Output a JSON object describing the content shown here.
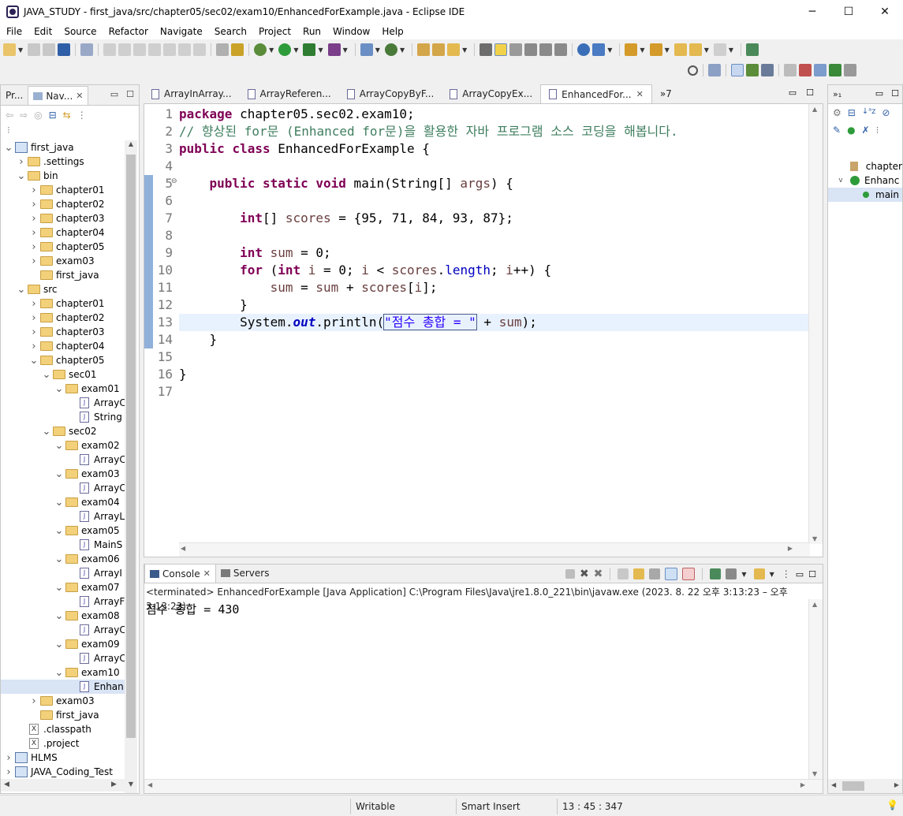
{
  "window": {
    "title": "JAVA_STUDY - first_java/src/chapter05/sec02/exam10/EnhancedForExample.java - Eclipse IDE",
    "minimize": "─",
    "maximize": "☐",
    "close": "✕"
  },
  "menu": [
    "File",
    "Edit",
    "Source",
    "Refactor",
    "Navigate",
    "Search",
    "Project",
    "Run",
    "Window",
    "Help"
  ],
  "left_panel": {
    "tabs": [
      {
        "label": "Pr...",
        "active": false
      },
      {
        "label": "Nav...",
        "active": true
      }
    ],
    "tree": [
      {
        "indent": 0,
        "chev": "v",
        "type": "project",
        "label": "first_java"
      },
      {
        "indent": 1,
        "chev": ">",
        "type": "folder",
        "label": ".settings"
      },
      {
        "indent": 1,
        "chev": "v",
        "type": "folder",
        "label": "bin"
      },
      {
        "indent": 2,
        "chev": ">",
        "type": "folder",
        "label": "chapter01"
      },
      {
        "indent": 2,
        "chev": ">",
        "type": "folder",
        "label": "chapter02"
      },
      {
        "indent": 2,
        "chev": ">",
        "type": "folder",
        "label": "chapter03"
      },
      {
        "indent": 2,
        "chev": ">",
        "type": "folder",
        "label": "chapter04"
      },
      {
        "indent": 2,
        "chev": ">",
        "type": "folder",
        "label": "chapter05"
      },
      {
        "indent": 2,
        "chev": ">",
        "type": "folder",
        "label": "exam03"
      },
      {
        "indent": 2,
        "chev": "",
        "type": "folder",
        "label": "first_java"
      },
      {
        "indent": 1,
        "chev": "v",
        "type": "folder",
        "label": "src"
      },
      {
        "indent": 2,
        "chev": ">",
        "type": "folder",
        "label": "chapter01"
      },
      {
        "indent": 2,
        "chev": ">",
        "type": "folder",
        "label": "chapter02"
      },
      {
        "indent": 2,
        "chev": ">",
        "type": "folder",
        "label": "chapter03"
      },
      {
        "indent": 2,
        "chev": ">",
        "type": "folder",
        "label": "chapter04"
      },
      {
        "indent": 2,
        "chev": "v",
        "type": "folder",
        "label": "chapter05"
      },
      {
        "indent": 3,
        "chev": "v",
        "type": "folder",
        "label": "sec01"
      },
      {
        "indent": 4,
        "chev": "v",
        "type": "folder",
        "label": "exam01"
      },
      {
        "indent": 5,
        "chev": "",
        "type": "java",
        "label": "ArrayC"
      },
      {
        "indent": 5,
        "chev": "",
        "type": "java",
        "label": "String"
      },
      {
        "indent": 3,
        "chev": "v",
        "type": "folder",
        "label": "sec02"
      },
      {
        "indent": 4,
        "chev": "v",
        "type": "folder",
        "label": "exam02"
      },
      {
        "indent": 5,
        "chev": "",
        "type": "java",
        "label": "ArrayC"
      },
      {
        "indent": 4,
        "chev": "v",
        "type": "folder",
        "label": "exam03"
      },
      {
        "indent": 5,
        "chev": "",
        "type": "java",
        "label": "ArrayC"
      },
      {
        "indent": 4,
        "chev": "v",
        "type": "folder",
        "label": "exam04"
      },
      {
        "indent": 5,
        "chev": "",
        "type": "java",
        "label": "ArrayL"
      },
      {
        "indent": 4,
        "chev": "v",
        "type": "folder",
        "label": "exam05"
      },
      {
        "indent": 5,
        "chev": "",
        "type": "java",
        "label": "MainS"
      },
      {
        "indent": 4,
        "chev": "v",
        "type": "folder",
        "label": "exam06"
      },
      {
        "indent": 5,
        "chev": "",
        "type": "java",
        "label": "ArrayI"
      },
      {
        "indent": 4,
        "chev": "v",
        "type": "folder",
        "label": "exam07"
      },
      {
        "indent": 5,
        "chev": "",
        "type": "java",
        "label": "ArrayF"
      },
      {
        "indent": 4,
        "chev": "v",
        "type": "folder",
        "label": "exam08"
      },
      {
        "indent": 5,
        "chev": "",
        "type": "java",
        "label": "ArrayC"
      },
      {
        "indent": 4,
        "chev": "v",
        "type": "folder",
        "label": "exam09"
      },
      {
        "indent": 5,
        "chev": "",
        "type": "java",
        "label": "ArrayC"
      },
      {
        "indent": 4,
        "chev": "v",
        "type": "folder",
        "label": "exam10"
      },
      {
        "indent": 5,
        "chev": "",
        "type": "java",
        "label": "Enhan",
        "selected": true
      },
      {
        "indent": 2,
        "chev": ">",
        "type": "folder",
        "label": "exam03"
      },
      {
        "indent": 2,
        "chev": "",
        "type": "folder",
        "label": "first_java"
      },
      {
        "indent": 1,
        "chev": "",
        "type": "xml",
        "label": ".classpath"
      },
      {
        "indent": 1,
        "chev": "",
        "type": "xml",
        "label": ".project"
      },
      {
        "indent": 0,
        "chev": ">",
        "type": "project",
        "label": "HLMS"
      },
      {
        "indent": 0,
        "chev": ">",
        "type": "project",
        "label": "JAVA_Coding_Test"
      }
    ]
  },
  "editor": {
    "tabs": [
      {
        "label": "ArrayInArray...",
        "active": false
      },
      {
        "label": "ArrayReferen...",
        "active": false
      },
      {
        "label": "ArrayCopyByF...",
        "active": false
      },
      {
        "label": "ArrayCopyEx...",
        "active": false
      },
      {
        "label": "EnhancedFor...",
        "active": true
      }
    ],
    "overflow": "»7",
    "line_numbers": [
      "1",
      "2",
      "3",
      "4",
      "5",
      "6",
      "7",
      "8",
      "9",
      "10",
      "11",
      "12",
      "13",
      "14",
      "15",
      "16",
      "17"
    ],
    "code": {
      "l1_kw": "package",
      "l1_rest": " chapter05.sec02.exam10;",
      "l2": "// 향상된 for문 (Enhanced for문)을 활용한 자바 프로그램 소스 코딩을 해봅니다.",
      "l3_kw1": "public",
      "l3_kw2": "class",
      "l3_rest": " EnhancedForExample {",
      "l5_kw": "public static void",
      "l5_rest1": " main(String[] ",
      "l5_args": "args",
      "l5_rest2": ") {",
      "l7_kw": "int",
      "l7_rest1": "[] ",
      "l7_var": "scores",
      "l7_rest2": " = {95, 71, 84, 93, 87};",
      "l9_kw": "int",
      "l9_var": "sum",
      "l9_rest": " = 0;",
      "l10_kw1": "for",
      "l10_kw2": "int",
      "l10_var1": "i",
      "l10_mid1": " = 0; ",
      "l10_var2": "i",
      "l10_mid2": " < ",
      "l10_var3": "scores",
      "l10_dot": ".",
      "l10_fld": "length",
      "l10_mid3": "; ",
      "l10_var4": "i",
      "l10_end": "++) {",
      "l11_var1": "sum",
      "l11_mid1": " = ",
      "l11_var2": "sum",
      "l11_mid2": " + ",
      "l11_var3": "scores",
      "l11_mid3": "[",
      "l11_var4": "i",
      "l11_end": "];",
      "l12": "}",
      "l13_pre": "System.",
      "l13_out": "out",
      "l13_mid": ".println(",
      "l13_str": "\"점수 총합 = \"",
      "l13_plus": " + ",
      "l13_var": "sum",
      "l13_end": ");",
      "l14": "}",
      "l16": "}"
    }
  },
  "console": {
    "tabs": [
      {
        "label": "Console",
        "active": true
      },
      {
        "label": "Servers",
        "active": false
      }
    ],
    "status": "<terminated> EnhancedForExample [Java Application] C:\\Program Files\\Java\\jre1.8.0_221\\bin\\javaw.exe  (2023. 8. 22 오후 3:13:23 – 오후 3:13:23)",
    "output": "점수 총합 = 430"
  },
  "outline": {
    "items": [
      {
        "label": "chapter",
        "indent": 0
      },
      {
        "label": "Enhanc",
        "indent": 0
      },
      {
        "label": "main",
        "indent": 1
      }
    ]
  },
  "statusbar": {
    "mode": "Writable",
    "insert": "Smart Insert",
    "position": "13 : 45 : 347"
  }
}
